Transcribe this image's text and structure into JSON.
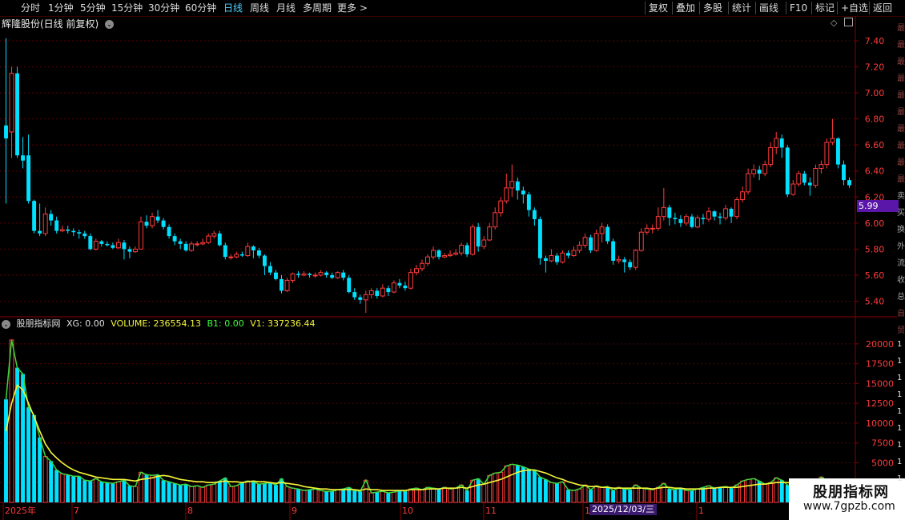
{
  "toolbar": {
    "left": [
      "分时",
      "1分钟",
      "5分钟",
      "15分钟",
      "30分钟",
      "60分钟",
      "日线",
      "周线",
      "月线",
      "多周期",
      "更多 >"
    ],
    "active_index": 6,
    "right": [
      "复权",
      "叠加",
      "多股",
      "统计",
      "画线",
      "F10",
      "标记",
      "+自选",
      "返回"
    ]
  },
  "main_chart": {
    "title": "辉隆股份(日线 前复权)",
    "price_axis": [
      "7.40",
      "7.20",
      "7.00",
      "6.80",
      "6.60",
      "6.40",
      "6.20",
      "6.00",
      "5.80",
      "5.60",
      "5.40"
    ],
    "current_price": "5.99",
    "ylim": [
      5.28,
      7.48
    ],
    "candles": [
      [
        6.75,
        6.65,
        7.42,
        6.15
      ],
      [
        6.7,
        7.15,
        7.2,
        6.5
      ],
      [
        7.15,
        6.52,
        7.2,
        6.5
      ],
      [
        6.52,
        6.48,
        6.66,
        6.42
      ],
      [
        6.52,
        6.17,
        6.68,
        6.15
      ],
      [
        6.17,
        5.94,
        6.18,
        5.92
      ],
      [
        5.94,
        5.92,
        6.15,
        5.9
      ],
      [
        5.92,
        6.07,
        6.12,
        5.9
      ],
      [
        6.07,
        6.02,
        6.1,
        5.98
      ],
      [
        6.02,
        5.94,
        6.05,
        5.92
      ],
      [
        5.94,
        5.95,
        5.98,
        5.93
      ],
      [
        5.95,
        5.94,
        5.98,
        5.92
      ],
      [
        5.94,
        5.93,
        5.96,
        5.9
      ],
      [
        5.93,
        5.92,
        5.95,
        5.88
      ],
      [
        5.92,
        5.9,
        5.94,
        5.88
      ],
      [
        5.9,
        5.8,
        5.92,
        5.79
      ],
      [
        5.8,
        5.86,
        5.88,
        5.79
      ],
      [
        5.86,
        5.84,
        5.87,
        5.82
      ],
      [
        5.84,
        5.83,
        5.86,
        5.82
      ],
      [
        5.83,
        5.81,
        5.85,
        5.8
      ],
      [
        5.81,
        5.85,
        5.88,
        5.8
      ],
      [
        5.85,
        5.8,
        5.87,
        5.72
      ],
      [
        5.8,
        5.78,
        5.82,
        5.73
      ],
      [
        5.78,
        5.8,
        5.82,
        5.77
      ],
      [
        5.8,
        6.01,
        6.05,
        5.8
      ],
      [
        6.01,
        5.98,
        6.06,
        5.96
      ],
      [
        5.98,
        6.05,
        6.08,
        5.96
      ],
      [
        6.05,
        6.02,
        6.1,
        6.0
      ],
      [
        6.02,
        5.97,
        6.04,
        5.95
      ],
      [
        5.97,
        5.9,
        5.99,
        5.88
      ],
      [
        5.9,
        5.86,
        5.92,
        5.83
      ],
      [
        5.86,
        5.84,
        5.88,
        5.8
      ],
      [
        5.84,
        5.79,
        5.86,
        5.78
      ],
      [
        5.79,
        5.84,
        5.86,
        5.78
      ],
      [
        5.84,
        5.84,
        5.86,
        5.82
      ],
      [
        5.84,
        5.85,
        5.88,
        5.83
      ],
      [
        5.85,
        5.9,
        5.92,
        5.84
      ],
      [
        5.9,
        5.92,
        5.94,
        5.88
      ],
      [
        5.92,
        5.83,
        5.94,
        5.82
      ],
      [
        5.83,
        5.74,
        5.85,
        5.72
      ],
      [
        5.74,
        5.74,
        5.76,
        5.72
      ],
      [
        5.74,
        5.76,
        5.78,
        5.73
      ],
      [
        5.76,
        5.75,
        5.78,
        5.74
      ],
      [
        5.75,
        5.82,
        5.85,
        5.74
      ],
      [
        5.82,
        5.79,
        5.83,
        5.73
      ],
      [
        5.79,
        5.75,
        5.81,
        5.73
      ],
      [
        5.75,
        5.67,
        5.76,
        5.6
      ],
      [
        5.67,
        5.62,
        5.7,
        5.6
      ],
      [
        5.62,
        5.57,
        5.64,
        5.56
      ],
      [
        5.57,
        5.48,
        5.6,
        5.46
      ],
      [
        5.48,
        5.56,
        5.58,
        5.47
      ],
      [
        5.56,
        5.61,
        5.62,
        5.54
      ],
      [
        5.61,
        5.6,
        5.63,
        5.58
      ],
      [
        5.6,
        5.61,
        5.63,
        5.59
      ],
      [
        5.61,
        5.6,
        5.62,
        5.58
      ],
      [
        5.6,
        5.6,
        5.62,
        5.58
      ],
      [
        5.6,
        5.62,
        5.64,
        5.59
      ],
      [
        5.62,
        5.6,
        5.63,
        5.58
      ],
      [
        5.6,
        5.58,
        5.62,
        5.57
      ],
      [
        5.58,
        5.62,
        5.63,
        5.57
      ],
      [
        5.62,
        5.58,
        5.64,
        5.56
      ],
      [
        5.58,
        5.47,
        5.6,
        5.46
      ],
      [
        5.47,
        5.43,
        5.5,
        5.41
      ],
      [
        5.43,
        5.41,
        5.45,
        5.38
      ],
      [
        5.41,
        5.45,
        5.48,
        5.31
      ],
      [
        5.45,
        5.48,
        5.5,
        5.42
      ],
      [
        5.48,
        5.44,
        5.5,
        5.42
      ],
      [
        5.44,
        5.5,
        5.53,
        5.43
      ],
      [
        5.5,
        5.47,
        5.52,
        5.44
      ],
      [
        5.47,
        5.54,
        5.56,
        5.46
      ],
      [
        5.54,
        5.52,
        5.57,
        5.5
      ],
      [
        5.52,
        5.5,
        5.55,
        5.48
      ],
      [
        5.5,
        5.62,
        5.65,
        5.49
      ],
      [
        5.62,
        5.65,
        5.68,
        5.6
      ],
      [
        5.65,
        5.69,
        5.72,
        5.63
      ],
      [
        5.69,
        5.74,
        5.76,
        5.67
      ],
      [
        5.74,
        5.79,
        5.82,
        5.72
      ],
      [
        5.79,
        5.74,
        5.8,
        5.72
      ],
      [
        5.74,
        5.75,
        5.77,
        5.73
      ],
      [
        5.75,
        5.76,
        5.79,
        5.74
      ],
      [
        5.76,
        5.77,
        5.8,
        5.75
      ],
      [
        5.77,
        5.83,
        5.85,
        5.75
      ],
      [
        5.83,
        5.76,
        5.85,
        5.74
      ],
      [
        5.76,
        5.97,
        5.99,
        5.75
      ],
      [
        5.97,
        5.82,
        6.0,
        5.78
      ],
      [
        5.82,
        5.87,
        5.9,
        5.8
      ],
      [
        5.87,
        5.97,
        6.0,
        5.86
      ],
      [
        5.97,
        6.08,
        6.12,
        5.95
      ],
      [
        6.08,
        6.17,
        6.2,
        6.05
      ],
      [
        6.17,
        6.27,
        6.38,
        6.15
      ],
      [
        6.27,
        6.32,
        6.45,
        6.2
      ],
      [
        6.32,
        6.25,
        6.35,
        6.18
      ],
      [
        6.25,
        6.22,
        6.28,
        6.15
      ],
      [
        6.22,
        6.1,
        6.24,
        6.05
      ],
      [
        6.1,
        6.03,
        6.12,
        5.98
      ],
      [
        6.03,
        5.73,
        6.05,
        5.68
      ],
      [
        5.73,
        5.71,
        5.75,
        5.62
      ],
      [
        5.71,
        5.75,
        5.8,
        5.7
      ],
      [
        5.75,
        5.7,
        5.77,
        5.68
      ],
      [
        5.7,
        5.77,
        5.79,
        5.69
      ],
      [
        5.77,
        5.75,
        5.79,
        5.73
      ],
      [
        5.75,
        5.79,
        5.82,
        5.74
      ],
      [
        5.79,
        5.83,
        5.86,
        5.77
      ],
      [
        5.83,
        5.89,
        5.92,
        5.81
      ],
      [
        5.89,
        5.79,
        5.91,
        5.77
      ],
      [
        5.79,
        5.92,
        5.95,
        5.78
      ],
      [
        5.92,
        5.97,
        6.0,
        5.85
      ],
      [
        5.97,
        5.86,
        5.99,
        5.84
      ],
      [
        5.86,
        5.71,
        5.88,
        5.68
      ],
      [
        5.71,
        5.72,
        5.75,
        5.69
      ],
      [
        5.72,
        5.7,
        5.74,
        5.62
      ],
      [
        5.7,
        5.66,
        5.72,
        5.64
      ],
      [
        5.66,
        5.79,
        5.8,
        5.64
      ],
      [
        5.79,
        5.93,
        5.96,
        5.78
      ],
      [
        5.93,
        5.96,
        5.99,
        5.91
      ],
      [
        5.96,
        5.96,
        5.99,
        5.92
      ],
      [
        5.96,
        6.05,
        6.12,
        5.94
      ],
      [
        6.05,
        6.12,
        6.27,
        6.02
      ],
      [
        6.12,
        6.04,
        6.14,
        5.98
      ],
      [
        6.04,
        6.03,
        6.08,
        5.99
      ],
      [
        6.03,
        6.0,
        6.06,
        5.97
      ],
      [
        6.0,
        6.05,
        6.07,
        5.98
      ],
      [
        6.05,
        5.97,
        6.07,
        5.96
      ],
      [
        5.97,
        6.04,
        6.06,
        5.96
      ],
      [
        6.04,
        6.03,
        6.07,
        5.99
      ],
      [
        6.03,
        6.09,
        6.12,
        6.01
      ],
      [
        6.09,
        6.05,
        6.1,
        6.02
      ],
      [
        6.05,
        6.04,
        6.08,
        5.99
      ],
      [
        6.04,
        6.11,
        6.14,
        6.02
      ],
      [
        6.11,
        6.05,
        6.12,
        6.0
      ],
      [
        6.05,
        6.18,
        6.2,
        6.03
      ],
      [
        6.18,
        6.24,
        6.28,
        6.16
      ],
      [
        6.24,
        6.38,
        6.42,
        6.22
      ],
      [
        6.38,
        6.41,
        6.45,
        6.35
      ],
      [
        6.41,
        6.38,
        6.44,
        6.33
      ],
      [
        6.38,
        6.45,
        6.48,
        6.36
      ],
      [
        6.45,
        6.58,
        6.62,
        6.43
      ],
      [
        6.58,
        6.65,
        6.7,
        6.53
      ],
      [
        6.65,
        6.58,
        6.68,
        6.5
      ],
      [
        6.58,
        6.22,
        6.6,
        6.2
      ],
      [
        6.22,
        6.3,
        6.33,
        6.21
      ],
      [
        6.3,
        6.38,
        6.4,
        6.28
      ],
      [
        6.38,
        6.31,
        6.4,
        6.29
      ],
      [
        6.31,
        6.29,
        6.35,
        6.21
      ],
      [
        6.29,
        6.42,
        6.45,
        6.27
      ],
      [
        6.42,
        6.45,
        6.48,
        6.38
      ],
      [
        6.45,
        6.62,
        6.65,
        6.42
      ],
      [
        6.62,
        6.65,
        6.8,
        6.6
      ],
      [
        6.65,
        6.45,
        6.66,
        6.42
      ],
      [
        6.45,
        6.33,
        6.48,
        6.29
      ],
      [
        6.33,
        6.29,
        6.35,
        6.27
      ]
    ]
  },
  "indicator": {
    "name": "股朋指标网",
    "xg": "XG: 0.00",
    "volume": "VOLUME: 236554.13",
    "b1": "B1: 0.00",
    "v1": "V1: 337236.44",
    "axis": [
      "20000",
      "17500",
      "15000",
      "12500",
      "10000",
      "7500",
      "5000",
      "2500"
    ],
    "ylim": [
      0,
      21600
    ],
    "volumes": [
      13000,
      20500,
      17000,
      16200,
      12000,
      11000,
      8200,
      5800,
      5200,
      4100,
      3600,
      3500,
      3300,
      3300,
      2800,
      2700,
      3000,
      2600,
      2500,
      2400,
      2600,
      2800,
      2100,
      2000,
      3800,
      3500,
      3400,
      3500,
      2800,
      2600,
      2400,
      2200,
      2300,
      2000,
      2100,
      1900,
      2200,
      2300,
      2700,
      3100,
      2000,
      2100,
      2500,
      2700,
      2600,
      2300,
      2400,
      2500,
      2200,
      3000,
      2000,
      1800,
      1700,
      1500,
      1600,
      1700,
      1500,
      1400,
      1400,
      1600,
      1700,
      1900,
      1500,
      1400,
      2800,
      1200,
      1300,
      1400,
      1200,
      1300,
      1500,
      1400,
      1700,
      1800,
      1600,
      1900,
      1800,
      1700,
      1900,
      1700,
      1800,
      2200,
      1500,
      2800,
      3000,
      2300,
      3400,
      3700,
      3800,
      4600,
      4800,
      4700,
      4500,
      4200,
      4000,
      3200,
      2900,
      2500,
      2400,
      2600,
      1600,
      1500,
      1700,
      2200,
      1600,
      2100,
      1900,
      2000,
      1500,
      1900,
      1700,
      1600,
      2200,
      1800,
      1700,
      1600,
      1900,
      2400,
      1700,
      1600,
      1800,
      1500,
      1500,
      1700,
      1900,
      2100,
      1800,
      1900,
      2000,
      1800,
      2200,
      2700,
      2900,
      3000,
      2700,
      2300,
      2500,
      3100,
      2800,
      2200,
      1800,
      1700,
      1800,
      1900,
      2000,
      3200,
      2800,
      2100,
      1900,
      1400,
      1600
    ],
    "ma": [
      9000,
      12500,
      14800,
      14200,
      12500,
      10800,
      9000,
      7400,
      6300,
      5600,
      5000,
      4500,
      4100,
      3800,
      3600,
      3400,
      3200,
      3100,
      3000,
      2900,
      2900,
      2900,
      2800,
      2700,
      2900,
      3000,
      3100,
      3300,
      3400,
      3300,
      3100,
      2900,
      2800,
      2700,
      2600,
      2600,
      2500,
      2500,
      2600,
      2700,
      2600,
      2600,
      2500,
      2600,
      2700,
      2600,
      2600,
      2500,
      2400,
      2500,
      2400,
      2300,
      2200,
      2000,
      1900,
      1800,
      1700,
      1700,
      1600,
      1600,
      1600,
      1600,
      1600,
      1500,
      1700,
      1600,
      1600,
      1500,
      1500,
      1500,
      1500,
      1500,
      1600,
      1600,
      1600,
      1700,
      1700,
      1700,
      1800,
      1800,
      1800,
      1900,
      1800,
      2000,
      2200,
      2300,
      2500,
      2700,
      2900,
      3200,
      3500,
      3800,
      4000,
      4100,
      4100,
      3900,
      3700,
      3400,
      3100,
      2900,
      2600,
      2400,
      2200,
      2100,
      2000,
      2000,
      1900,
      1900,
      1800,
      1800,
      1800,
      1800,
      1800,
      1800,
      1800,
      1700,
      1800,
      1900,
      1900,
      1800,
      1800,
      1700,
      1700,
      1700,
      1700,
      1800,
      1800,
      1900,
      1900,
      1900,
      1900,
      2000,
      2100,
      2200,
      2300,
      2300,
      2400,
      2500,
      2500,
      2500,
      2400,
      2300,
      2200,
      2100,
      2000,
      2200,
      2400,
      2400,
      2300,
      2100,
      2000
    ]
  },
  "date_axis": {
    "labels": [
      "2025年",
      "7",
      "8",
      "9",
      "10",
      "11",
      "12",
      "1"
    ],
    "highlight": "2025/12/03/三"
  },
  "right_strip_chars": [
    "最",
    "最",
    "最",
    "最",
    "最",
    "最",
    "最",
    "最",
    "最",
    "最",
    "卖",
    "买",
    "换",
    "外",
    "流",
    "收",
    "总",
    "自",
    "贸",
    "1",
    "1",
    "1",
    "1",
    "1",
    "1",
    "1",
    "1",
    "1"
  ],
  "watermark": {
    "line1": "股朋指标网",
    "line2": "www.7gpzb.com"
  },
  "colors": {
    "up": "#ff3c3c",
    "down": "#00e0ff",
    "ma": "#f5f53a",
    "grid": "#5a0000",
    "border": "#8b0000",
    "price_tag": "#5a16a8",
    "active_tab": "#4fd1ff"
  }
}
